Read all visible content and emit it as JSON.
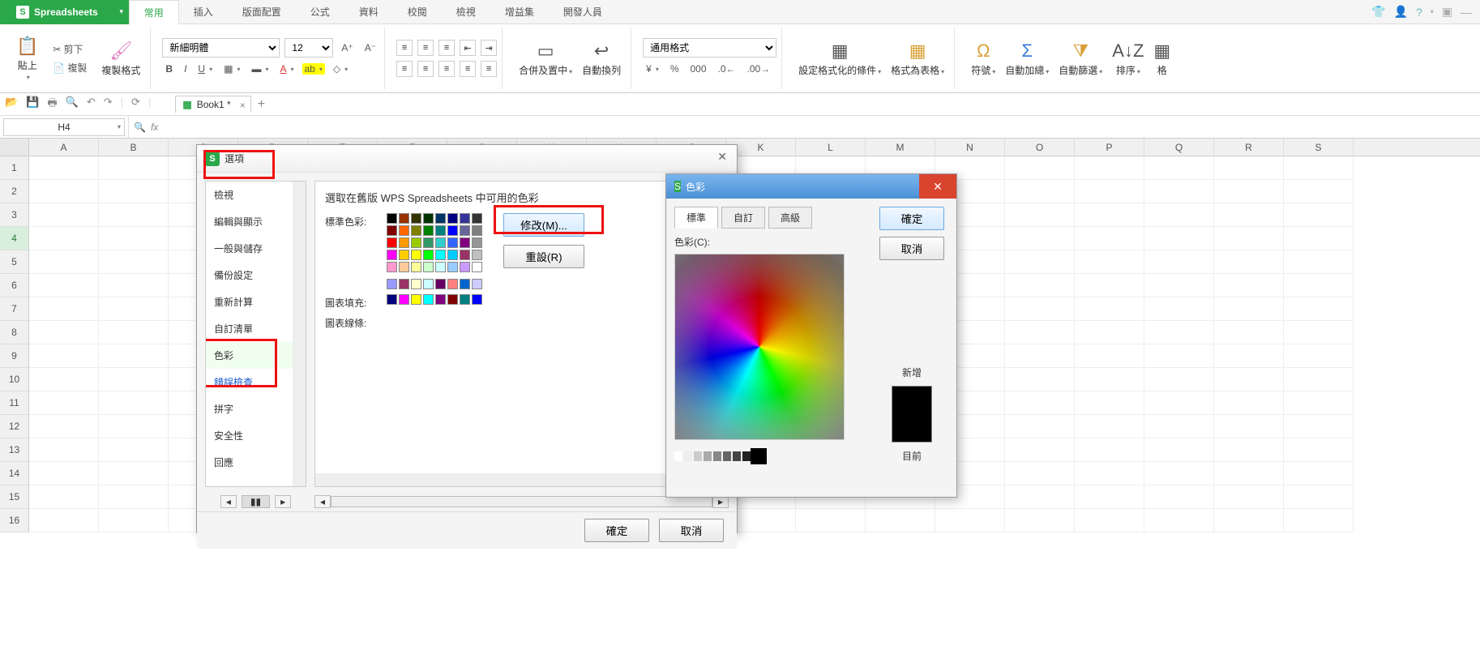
{
  "app": {
    "title": "Spreadsheets"
  },
  "menu": {
    "tabs": [
      "常用",
      "插入",
      "版面配置",
      "公式",
      "資料",
      "校閱",
      "檢視",
      "增益集",
      "開發人員"
    ],
    "active": 0
  },
  "ribbon": {
    "paste": "貼上",
    "cut": "剪下",
    "copy": "複製",
    "format_painter": "複製格式",
    "font": "新細明體",
    "font_size": "12",
    "merge_center": "合併及置中",
    "wrap": "自動換列",
    "number_format": "通用格式",
    "cond_format": "設定格式化的條件",
    "as_table": "格式為表格",
    "symbol": "符號",
    "autosum": "自動加總",
    "autofilter": "自動篩選",
    "sort": "排序",
    "style": "格"
  },
  "doc": {
    "name": "Book1 *"
  },
  "namebox": {
    "cell": "H4",
    "fx": "fx"
  },
  "grid": {
    "cols": [
      "A",
      "B",
      "C",
      "D",
      "E",
      "F",
      "G",
      "H",
      "I",
      "J",
      "K",
      "L",
      "M",
      "N",
      "O",
      "P",
      "Q",
      "R",
      "S"
    ],
    "rows": [
      1,
      2,
      3,
      4,
      5,
      6,
      7,
      8,
      9,
      10,
      11,
      12,
      13,
      14,
      15,
      16
    ],
    "selected_row": 4
  },
  "options_dialog": {
    "title": "選項",
    "sidebar": [
      "檢視",
      "編輯與顯示",
      "一般與儲存",
      "備份設定",
      "重新計算",
      "自訂清單",
      "色彩",
      "錯誤檢查",
      "拼字",
      "安全性",
      "回應"
    ],
    "selected": "色彩",
    "heading": "選取在舊版 WPS Spreadsheets 中可用的色彩",
    "label_standard": "標準色彩:",
    "label_chart_fill": "圖表填充:",
    "label_chart_line": "圖表線條:",
    "btn_modify": "修改(M)...",
    "btn_reset": "重設(R)",
    "ok": "確定",
    "cancel": "取消",
    "standard_colors": [
      [
        "#000000",
        "#993300",
        "#333300",
        "#003300",
        "#003366",
        "#000080",
        "#333399",
        "#333333"
      ],
      [
        "#800000",
        "#ff6600",
        "#808000",
        "#008000",
        "#008080",
        "#0000ff",
        "#666699",
        "#808080"
      ],
      [
        "#ff0000",
        "#ff9900",
        "#99cc00",
        "#339966",
        "#33cccc",
        "#3366ff",
        "#800080",
        "#969696"
      ],
      [
        "#ff00ff",
        "#ffcc00",
        "#ffff00",
        "#00ff00",
        "#00ffff",
        "#00ccff",
        "#993366",
        "#c0c0c0"
      ],
      [
        "#ff99cc",
        "#ffcc99",
        "#ffff99",
        "#ccffcc",
        "#ccffff",
        "#99ccff",
        "#cc99ff",
        "#ffffff"
      ]
    ],
    "standard_colors_extra": [
      [
        "#9999ff",
        "#993366",
        "#ffffcc",
        "#ccffff",
        "#660066",
        "#ff8080",
        "#0066cc",
        "#ccccff"
      ]
    ],
    "chart_fill_colors": [
      [
        "#000080",
        "#ff00ff",
        "#ffff00",
        "#00ffff",
        "#800080",
        "#800000",
        "#008080",
        "#0000ff"
      ]
    ]
  },
  "color_dialog": {
    "title": "色彩",
    "tab_standard": "標準",
    "tab_custom": "自訂",
    "tab_advanced": "高級",
    "label_colors": "色彩(C):",
    "ok": "確定",
    "cancel": "取消",
    "label_new": "新增",
    "label_current": "目前"
  }
}
